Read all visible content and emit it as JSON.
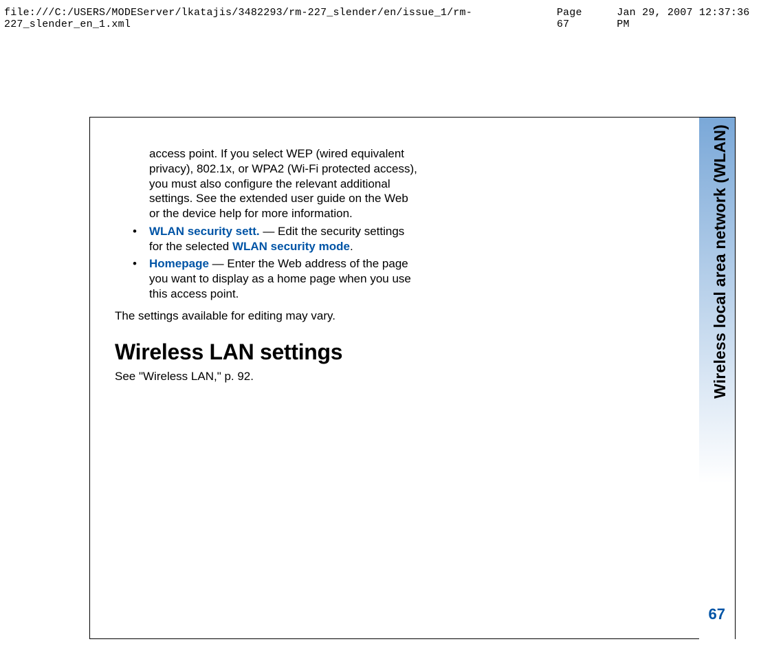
{
  "header": {
    "path": "file:///C:/USERS/MODEServer/lkatajis/3482293/rm-227_slender/en/issue_1/rm-227_slender_en_1.xml",
    "page_label": "Page 67",
    "timestamp": "Jan 29, 2007 12:37:36 PM"
  },
  "side": {
    "label": "Wireless local area network (WLAN)",
    "page_number": "67"
  },
  "body": {
    "continuation": "access point. If you select WEP (wired equivalent privacy), 802.1x, or WPA2 (Wi-Fi protected access), you must also configure the relevant additional settings. See the extended user guide on the Web or the device help for more information.",
    "bullets": [
      {
        "term": "WLAN security sett.",
        "sep": " — ",
        "pre": "Edit the security settings for the selected ",
        "inline_term": "WLAN security mode",
        "post": "."
      },
      {
        "term": "Homepage",
        "sep": " — ",
        "pre": "Enter the Web address of the page you want to display as a home page when you use this access point.",
        "inline_term": "",
        "post": ""
      }
    ],
    "closing": "The settings available for editing may vary.",
    "heading": "Wireless LAN settings",
    "see_ref": "See \"Wireless LAN,\" p. 92."
  }
}
